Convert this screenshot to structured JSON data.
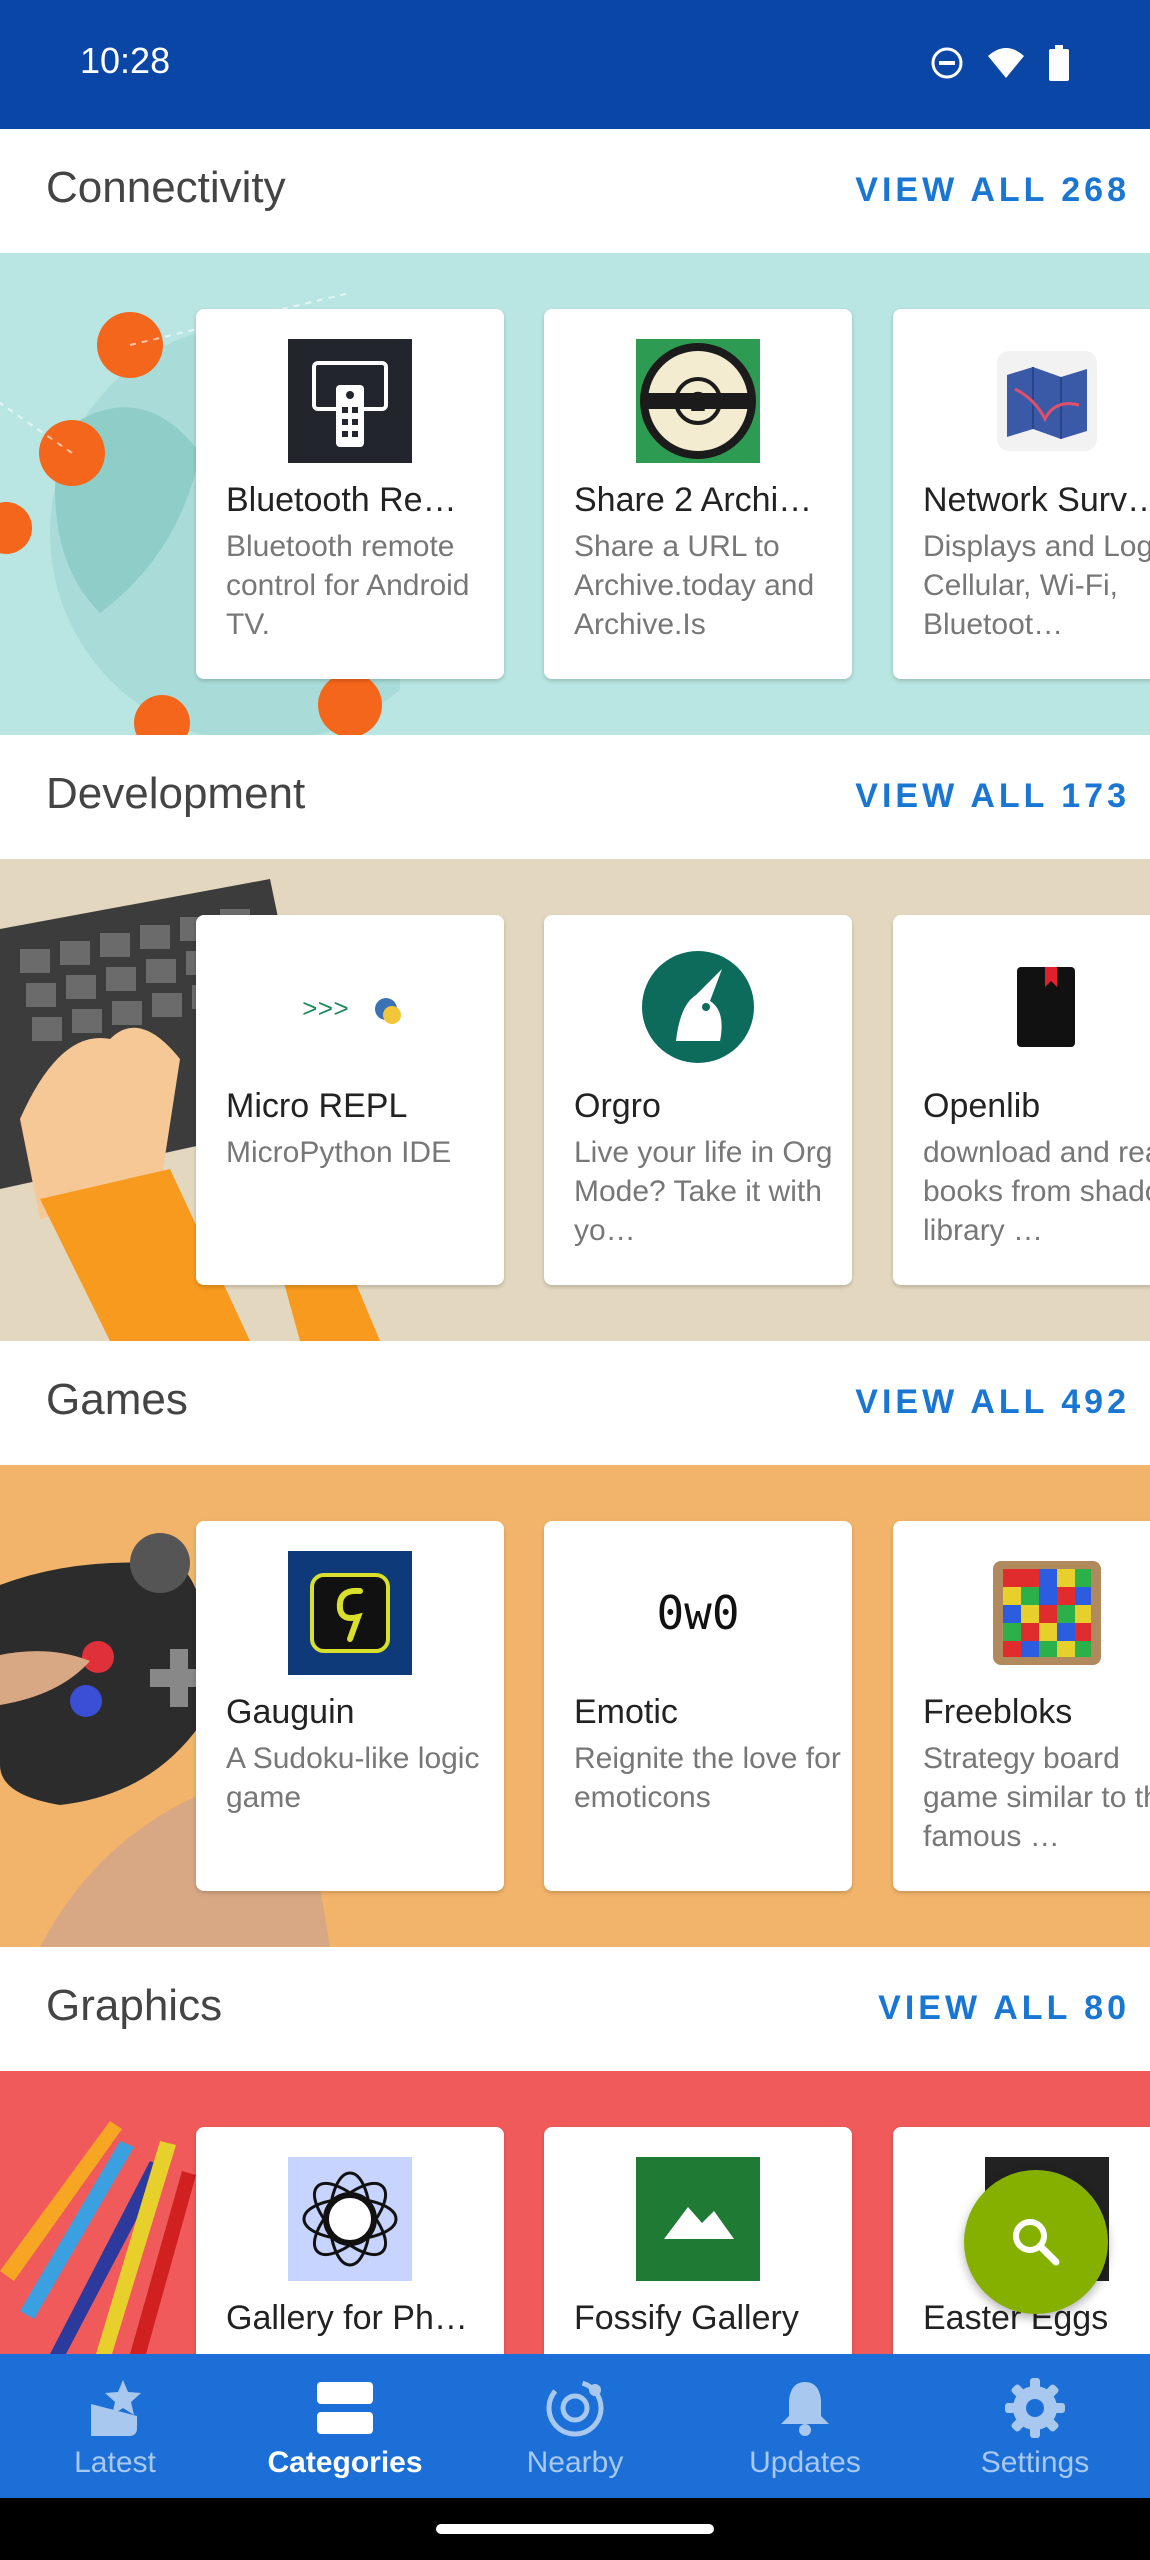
{
  "status_bar": {
    "time": "10:28"
  },
  "categories": [
    {
      "title": "Connectivity",
      "view_all": "VIEW ALL 268",
      "apps": [
        {
          "name": "Bluetooth Re…",
          "desc": "Bluetooth remote control for Android TV."
        },
        {
          "name": "Share 2 Archi…",
          "desc": "Share a URL to Archive.today and Archive.Is"
        },
        {
          "name": "Network Surv…",
          "desc": "Displays and Logs Cellular, Wi-Fi, Bluetoot…"
        }
      ]
    },
    {
      "title": "Development",
      "view_all": "VIEW ALL 173",
      "apps": [
        {
          "name": "Micro REPL",
          "desc": "MicroPython IDE"
        },
        {
          "name": "Orgro",
          "desc": "Live your life in Org Mode? Take it with yo…"
        },
        {
          "name": "Openlib",
          "desc": "download and read books from shadow library …"
        }
      ]
    },
    {
      "title": "Games",
      "view_all": "VIEW ALL 492",
      "apps": [
        {
          "name": "Gauguin",
          "desc": "A Sudoku-like logic game"
        },
        {
          "name": "Emotic",
          "desc": "Reignite the love for emoticons",
          "icon_text": "0w0"
        },
        {
          "name": "Freebloks",
          "desc": "Strategy board game similar to the famous …"
        }
      ]
    },
    {
      "title": "Graphics",
      "view_all": "VIEW ALL 80",
      "apps": [
        {
          "name": "Gallery for Ph…",
          "desc": ""
        },
        {
          "name": "Fossify Gallery",
          "desc": ""
        },
        {
          "name": "Easter Eggs",
          "desc": ""
        }
      ]
    }
  ],
  "bottom_nav": [
    {
      "label": "Latest",
      "icon": "star-icon"
    },
    {
      "label": "Categories",
      "icon": "categories-icon",
      "active": true
    },
    {
      "label": "Nearby",
      "icon": "nearby-icon"
    },
    {
      "label": "Updates",
      "icon": "bell-icon"
    },
    {
      "label": "Settings",
      "icon": "gear-icon"
    }
  ],
  "colors": {
    "primary": "#0a46a5",
    "nav": "#1c6fd6",
    "accent": "#1976d2",
    "fab": "#86b000",
    "connectivity_bg": "#b9e6e2",
    "development_bg": "#e3d8bf",
    "games_bg": "#f2b46a",
    "graphics_bg": "#f05a5a"
  }
}
